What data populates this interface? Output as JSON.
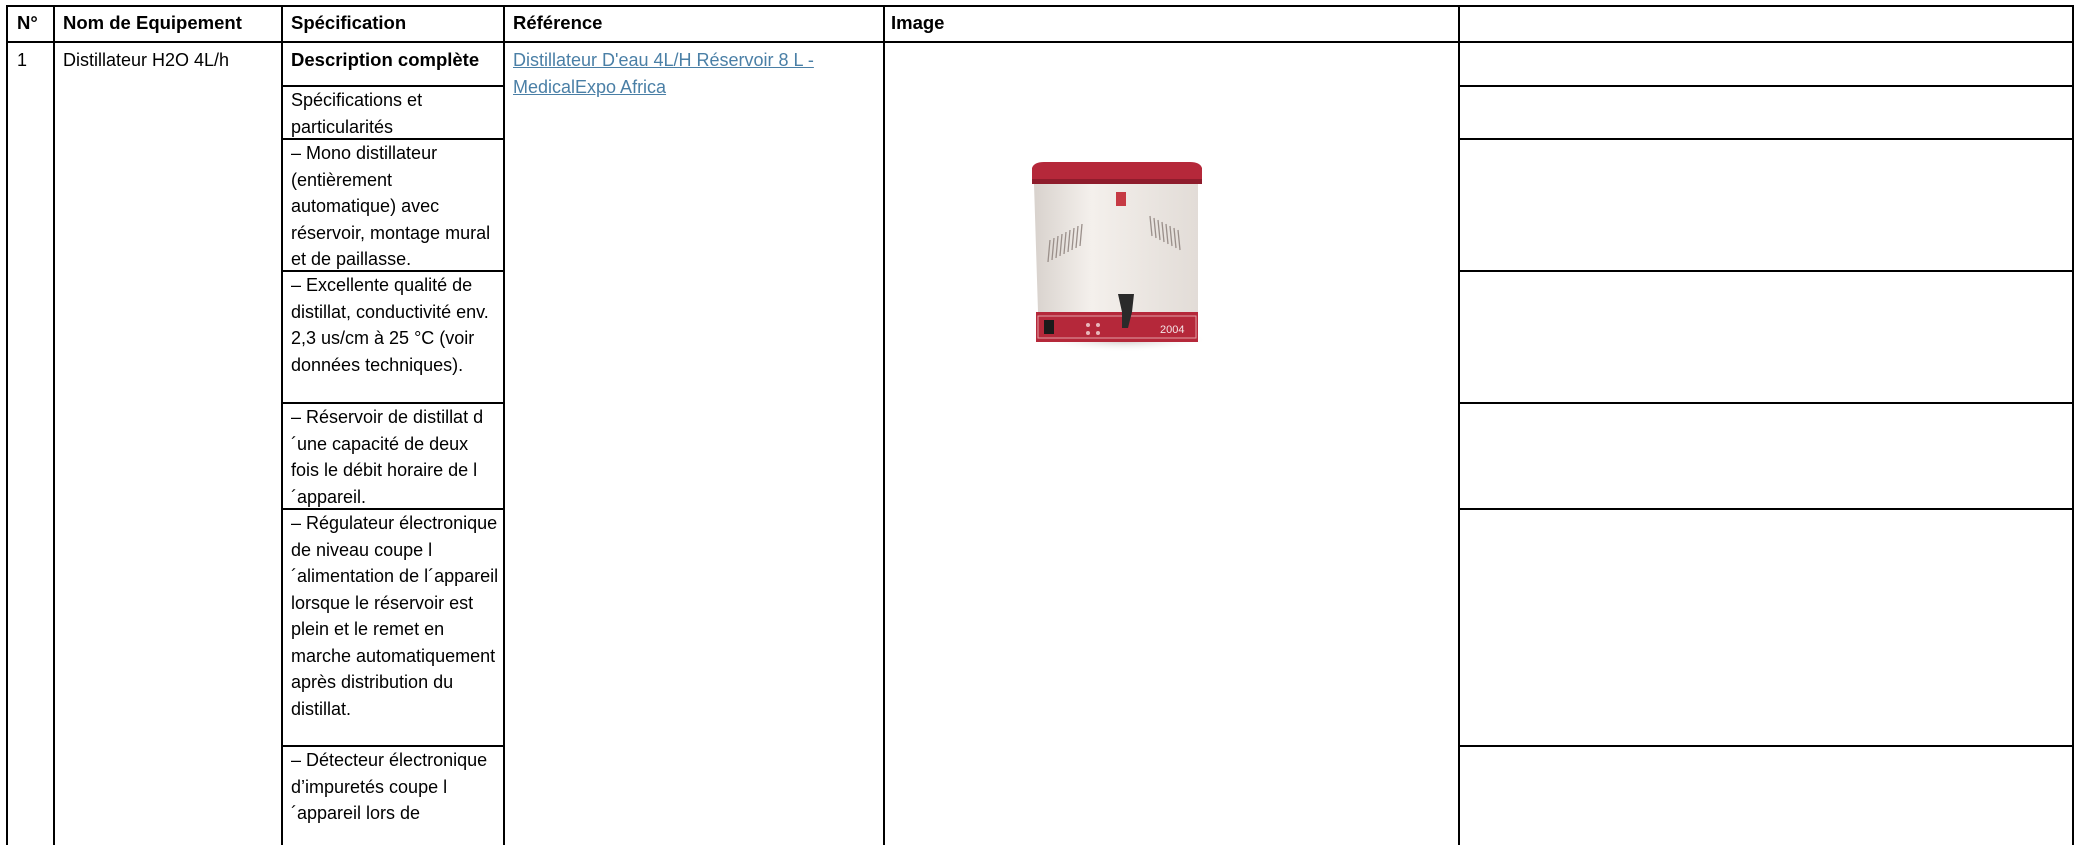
{
  "table": {
    "headers": {
      "num": "N°",
      "name": "Nom de Equipement",
      "spec": "Spécification",
      "ref": "Référence",
      "image": "Image",
      "extra": ""
    },
    "row": {
      "num": "1",
      "name": "Distillateur H2O 4L/h",
      "reference_link": "Distillateur D'eau 4L/H Réservoir 8 L - MedicalExpo Africa",
      "spec_cells": [
        "Description complète",
        "Spécifications et particularités",
        "– Mono distillateur (entièrement automatique) avec réservoir, montage mural et de paillasse.",
        "– Excellente qualité de distillat, conductivité env. 2,3 us/cm à 25 °C (voir données techniques).",
        "– Réservoir de distillat d´une capacité de deux fois le débit horaire de l´appareil.",
        "– Régulateur électronique de niveau coupe l´alimentation de l´appareil lorsque le réservoir est plein et le remet en marche automatiquement après distribution du distillat.",
        "– Détecteur électronique d’impuretés coupe l´appareil lors de"
      ]
    },
    "image": {
      "icon": "water-distiller-photo",
      "device_label": "2004"
    }
  },
  "colors": {
    "border": "#000000",
    "link": "#4a7fa6",
    "device_red": "#b5283a",
    "device_body": "#efeae6"
  }
}
